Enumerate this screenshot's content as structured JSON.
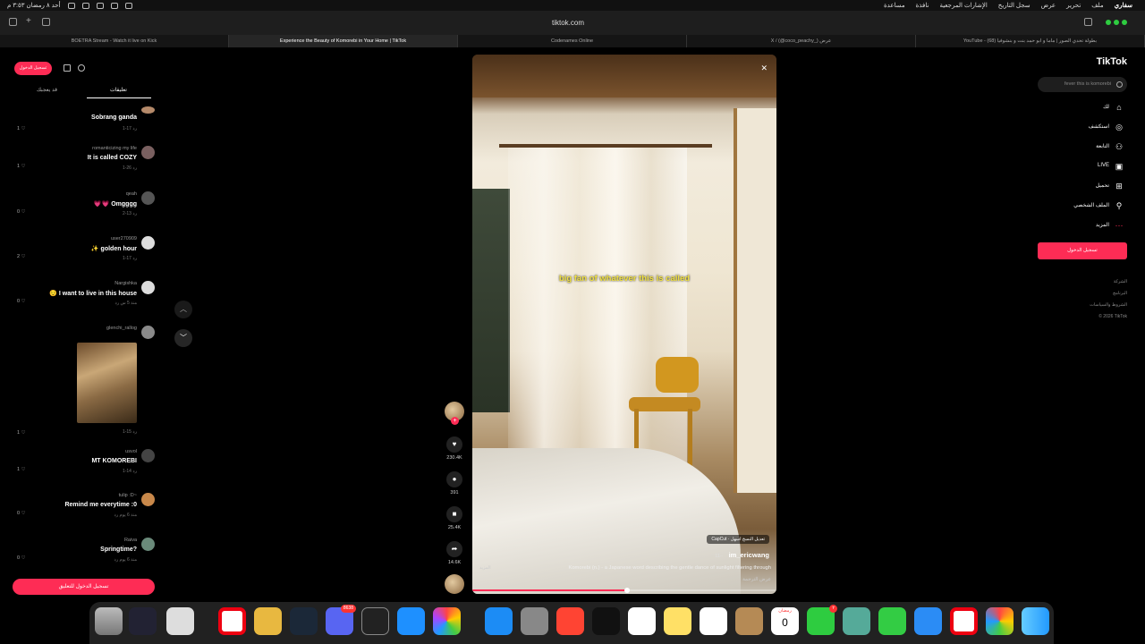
{
  "menubar": {
    "app": "سفاري",
    "items": [
      "ملف",
      "تحرير",
      "عرض",
      "سجل التاريخ",
      "الإشارات المرجعية",
      "نافذة",
      "مساعدة"
    ],
    "clock": "أحد ٨ رمضان ٣:٥٣ م"
  },
  "browser": {
    "address": "tiktok.com",
    "tabs": [
      "BOETRA Stream - Watch it live on Kick",
      "Experience the Beauty of Komorebi in Your Home | TikTok",
      "Codenames Online",
      "X / (@coco_peachy_) عرض",
      "YouTube - (68) بطولة تحدي الصور | ماما و ابو حمد بنت و بنشوفيا"
    ]
  },
  "comments_panel": {
    "login_top": "تسجيل الدخول",
    "tabs": [
      "تعليقات",
      "قد يعجبك"
    ],
    "login_bottom": "تسجيل الدخول للتعليق",
    "comments": [
      {
        "name": "",
        "text": "Sobrang ganda",
        "meta": "1-17   رد",
        "likes": "1",
        "avatar": "#b58a6a"
      },
      {
        "name": "romanticizing my life",
        "text": "It is called COZY",
        "meta": "1-26   رد",
        "likes": "1",
        "avatar": "#7a6060"
      },
      {
        "name": "qeah",
        "text": "💗💗 Omgggg",
        "meta": "2-13   رد",
        "likes": "0",
        "avatar": "#555"
      },
      {
        "name": "user270909",
        "text": "✨ golden hour",
        "meta": "1-17   رد",
        "likes": "2",
        "avatar": "#ddd"
      },
      {
        "name": "Nargishka",
        "text": "😌 I want to live in this house",
        "meta": "منذ 5 س   رد",
        "likes": "0",
        "avatar": "#ddd"
      },
      {
        "name": "glenchi_rallog",
        "text": "",
        "meta": "1-15   رد",
        "likes": "1",
        "avatar": "#8a8a8a"
      },
      {
        "name": "usvol",
        "text": "MT KOMOREBI",
        "meta": "1-14   رد",
        "likes": "1",
        "avatar": "#444"
      },
      {
        "name": "tulip :D~",
        "text": "Remind me everytime :0",
        "meta": "منذ 6 يوم   رد",
        "likes": "0",
        "avatar": "#c8884a"
      },
      {
        "name": "Raiva",
        "text": "Springtime?",
        "meta": "منذ 6 يوم   رد",
        "likes": "0",
        "avatar": "#6a8a7a"
      }
    ]
  },
  "video": {
    "subtitle": "big fan of whatever this is called",
    "badge": "CapCut · تعديل النسخ اسهل",
    "username": "im_ericwang",
    "date": "11-·",
    "description": "Komorebi (n.) - a Japanese word describing the gentle dance of sunlight filtering through",
    "more": "المزيد",
    "translate": "عرض الترجمة",
    "progress": 0.51
  },
  "actions": {
    "likes": "230.4K",
    "comments": "391",
    "saves": "25.4K",
    "shares": "14.6K"
  },
  "right_nav": {
    "logo": "TikTok",
    "search_placeholder": "fever this is komorebi",
    "items": [
      "لك",
      "استكشف",
      "التابعة",
      "LIVE",
      "تحميل",
      "الملف الشخصي",
      "المزيد"
    ],
    "login": "تسجيل الدخول",
    "footer": [
      "الشركة",
      "البرنامج",
      "الشروط والسياسات",
      "© 2026 TikTok"
    ]
  },
  "dock": {
    "discord_badge": "8638",
    "calendar_month": "رمضان",
    "calendar_day": "0",
    "facetime_badge": "٢"
  }
}
